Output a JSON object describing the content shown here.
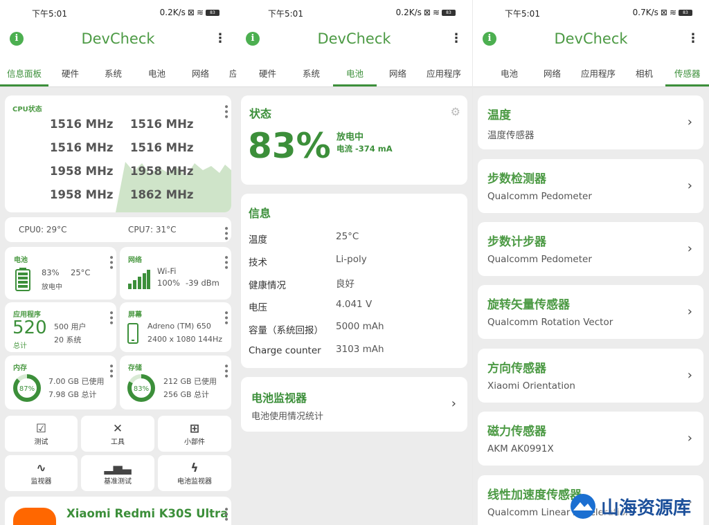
{
  "app_title": "DevCheck",
  "icons": {
    "info": "info-icon",
    "menu": "kebab-menu-icon",
    "chevron": "chevron-right-icon"
  },
  "colors": {
    "accent": "#4c9a44",
    "tab_active": "#3c8f3a"
  },
  "panels": [
    {
      "status": {
        "time": "下午5:01",
        "speed": "0.2K/s",
        "battery": "83"
      },
      "tabs": [
        "信息面板",
        "硬件",
        "系统",
        "电池",
        "网络",
        "应"
      ],
      "active_tab": "信息面板",
      "cpu": {
        "title": "CPU状态",
        "freqs": [
          "1516 MHz",
          "1516 MHz",
          "1516 MHz",
          "1516 MHz",
          "1958 MHz",
          "1958 MHz",
          "1958 MHz",
          "1862 MHz"
        ]
      },
      "temps": {
        "cpu0": "CPU0: 29°C",
        "cpu7": "CPU7: 31°C"
      },
      "battery_tile": {
        "title": "电池",
        "level": "83%",
        "temp": "25°C",
        "state": "放电中"
      },
      "network_tile": {
        "title": "网络",
        "type": "Wi-Fi",
        "signal": "100%",
        "dbm": "-39 dBm"
      },
      "apps_tile": {
        "title": "应用程序",
        "count": "520",
        "total_label": "总计",
        "user": "500 用户",
        "system": "20 系统"
      },
      "screen_tile": {
        "title": "屏幕",
        "gpu": "Adreno (TM) 650",
        "res": "2400 x 1080  144Hz"
      },
      "memory_tile": {
        "title": "内存",
        "percent": "87%",
        "used": "7.00 GB 已使用",
        "total": "7.98 GB 总计",
        "fraction": 0.87
      },
      "storage_tile": {
        "title": "存储",
        "percent": "83%",
        "used": "212 GB 已使用",
        "total": "256 GB 总计",
        "fraction": 0.83
      },
      "tools": [
        {
          "label": "测试",
          "icon": "checklist-icon"
        },
        {
          "label": "工具",
          "icon": "tools-icon"
        },
        {
          "label": "小部件",
          "icon": "widgets-icon"
        },
        {
          "label": "监视器",
          "icon": "pulse-icon"
        },
        {
          "label": "基准测试",
          "icon": "bar-chart-icon"
        },
        {
          "label": "电池监视器",
          "icon": "bolt-icon"
        }
      ],
      "device": {
        "name": "Xiaomi Redmi K30S Ultra"
      }
    },
    {
      "status": {
        "time": "下午5:01",
        "speed": "0.2K/s",
        "battery": "83"
      },
      "tabs": [
        "硬件",
        "系统",
        "电池",
        "网络",
        "应用程序"
      ],
      "active_tab": "电池",
      "state_card": {
        "title": "状态",
        "percent": "83%",
        "state": "放电中",
        "current": "电流 -374 mA"
      },
      "info_card": {
        "title": "信息",
        "rows": [
          {
            "k": "温度",
            "v": "25°C"
          },
          {
            "k": "技术",
            "v": "Li-poly"
          },
          {
            "k": "健康情况",
            "v": "良好"
          },
          {
            "k": "电压",
            "v": "4.041 V"
          },
          {
            "k": "容量（系统回报）",
            "v": "5000 mAh"
          },
          {
            "k": "Charge counter",
            "v": "3103 mAh"
          }
        ]
      },
      "monitor_card": {
        "title": "电池监视器",
        "sub": "电池使用情况统计"
      }
    },
    {
      "status": {
        "time": "下午5:01",
        "speed": "0.7K/s",
        "battery": "83"
      },
      "tabs": [
        "电池",
        "网络",
        "应用程序",
        "相机",
        "传感器"
      ],
      "active_tab": "传感器",
      "sensors": [
        {
          "title": "温度",
          "sub": "温度传感器"
        },
        {
          "title": "步数检测器",
          "sub": "Qualcomm Pedometer"
        },
        {
          "title": "步数计步器",
          "sub": "Qualcomm Pedometer"
        },
        {
          "title": "旋转矢量传感器",
          "sub": "Qualcomm Rotation Vector"
        },
        {
          "title": "方向传感器",
          "sub": "Xiaomi Orientation"
        },
        {
          "title": "磁力传感器",
          "sub": "AKM AK0991X"
        },
        {
          "title": "线性加速度传感器",
          "sub": "Qualcomm Linear Acceleration"
        }
      ]
    }
  ],
  "watermark": "山海资源库"
}
